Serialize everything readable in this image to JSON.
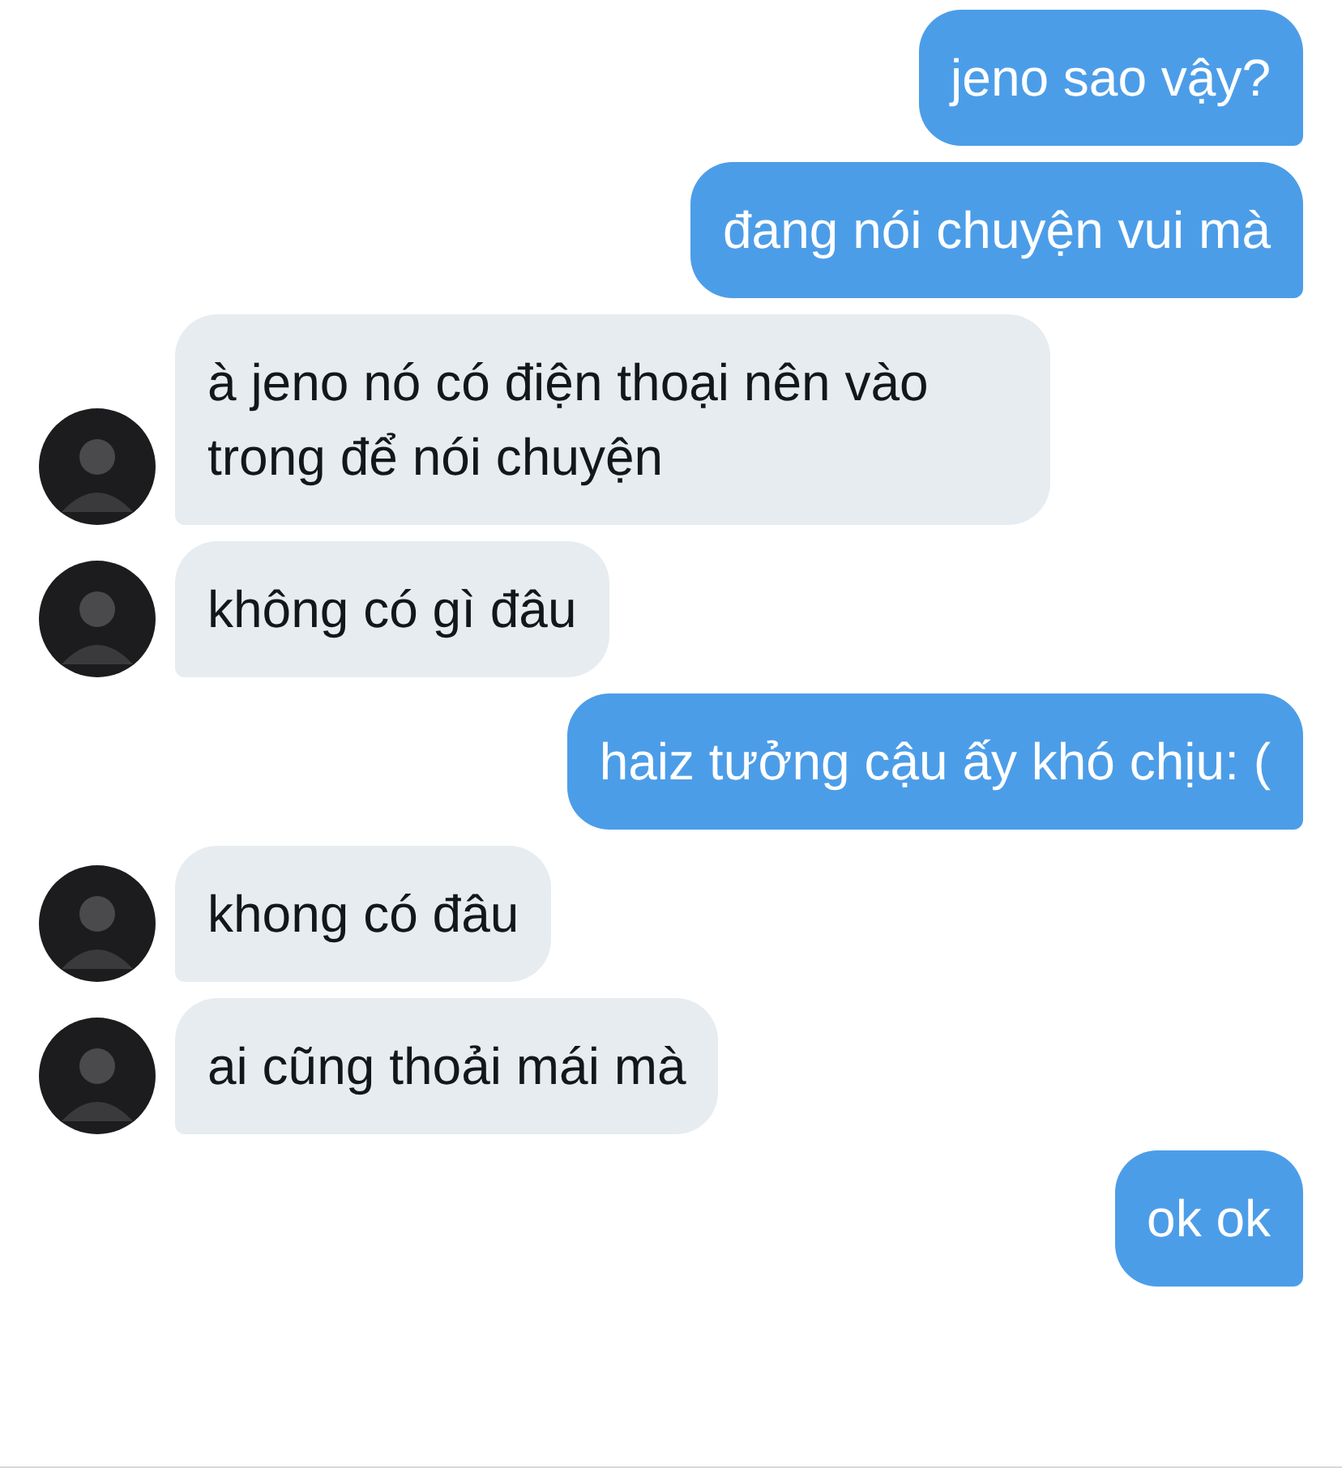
{
  "messages": [
    {
      "kind": "sent",
      "text": "jeno sao vậy?"
    },
    {
      "kind": "sent",
      "text": "đang nói chuyện vui mà"
    },
    {
      "kind": "received",
      "text": "à jeno nó có điện thoại nên vào trong để nói chuyện"
    },
    {
      "kind": "received",
      "text": "không có gì đâu"
    },
    {
      "kind": "sent",
      "text": "haiz tưởng cậu ấy khó chịu: ("
    },
    {
      "kind": "received",
      "text": "khong có đâu"
    },
    {
      "kind": "received",
      "text": "ai cũng thoải mái mà"
    },
    {
      "kind": "sent",
      "text": "ok ok"
    }
  ]
}
